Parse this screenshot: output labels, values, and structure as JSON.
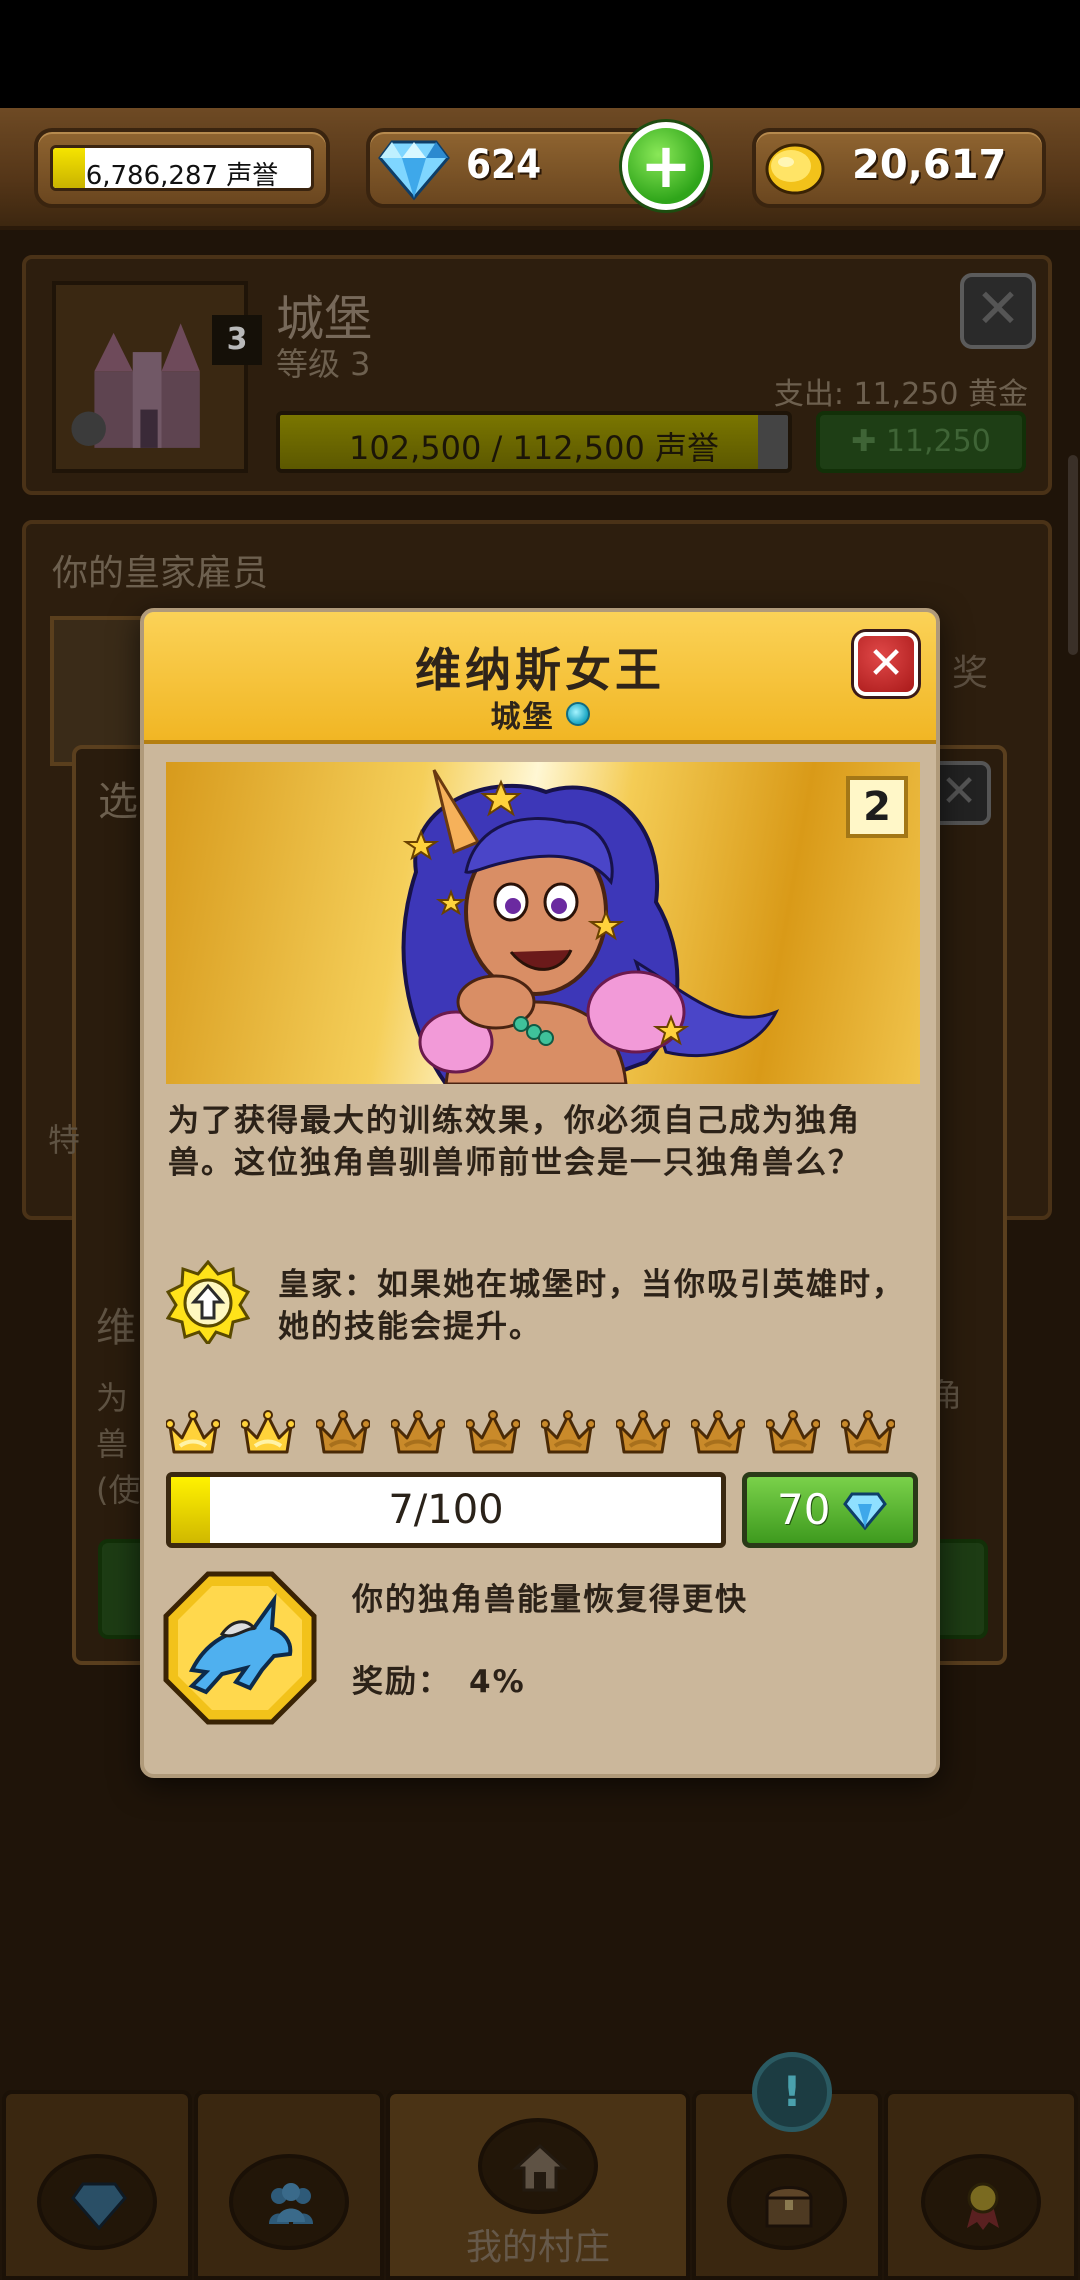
{
  "topbar": {
    "fame_value": "6,786,287 声誉",
    "gems_value": "624",
    "add_gems_label": "+",
    "gold_value": "20,617"
  },
  "castle_panel": {
    "level_badge": "3",
    "title": "城堡",
    "level_text": "等级 3",
    "cost_text": "支出: 11,250 黄金",
    "progress_text": "102,500 / 112,500 声誉",
    "upgrade_button_label": "11,250",
    "close_label": "✕"
  },
  "staff_panel": {
    "title": "你的皇家雇员",
    "right_text": "奖"
  },
  "select_panel": {
    "title": "选",
    "close_label": "✕",
    "side_text_1": "维",
    "side_text_2": "为\n兽\n(使",
    "side_text_3": "特",
    "right_text": "角"
  },
  "dialog": {
    "title": "维纳斯女王",
    "subtitle": "城堡",
    "close_label": "✕",
    "portrait_number": "2",
    "description": "为了获得最大的训练效果，你必须自己成为独角兽。这位独角兽驯兽师前世会是一只独角兽么？",
    "ability_text": "皇家：如果她在城堡时，当你吸引英雄时，她的技能会提升。",
    "crowns_total": 10,
    "crowns_earned": 2,
    "training_text": "7/100",
    "training_progress": 0.07,
    "buy_price": "70",
    "skill_description": "你的独角兽能量恢复得更快",
    "reward_label": "奖励：",
    "reward_value": "4%"
  },
  "bottom_nav": {
    "tabs": [
      "gems",
      "heroes",
      "village",
      "chest",
      "awards"
    ],
    "village_label": "我的村庄",
    "alert_label": "!"
  },
  "colors": {
    "header_yellow": "#f1b624",
    "dialog_body": "#cbb79b",
    "green_button": "#3e9a1e",
    "close_red": "#a91919"
  }
}
